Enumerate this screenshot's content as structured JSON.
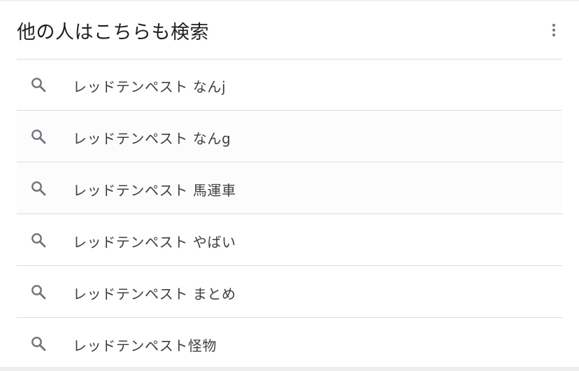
{
  "panel": {
    "title": "他の人はこちらも検索",
    "more_icon": "more-vert-icon",
    "search_icon": "search-icon",
    "icon_color": "#70757a",
    "text_color": "#3c4043"
  },
  "suggestions": [
    {
      "label": "レッドテンペスト なんj"
    },
    {
      "label": "レッドテンペスト なんg"
    },
    {
      "label": "レッドテンペスト 馬運車"
    },
    {
      "label": "レッドテンペスト やばい"
    },
    {
      "label": "レッドテンペスト まとめ"
    },
    {
      "label": "レッドテンペスト怪物"
    }
  ]
}
